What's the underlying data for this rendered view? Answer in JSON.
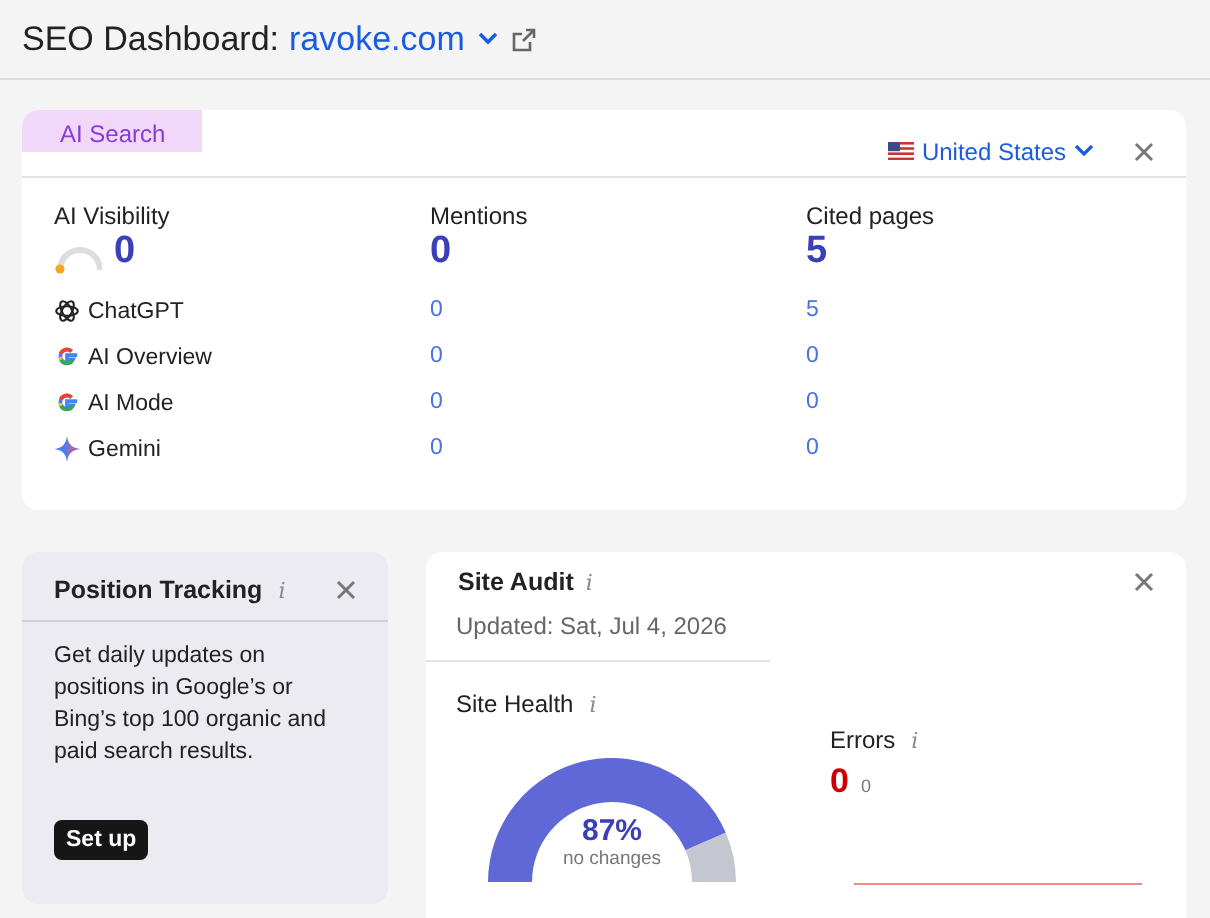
{
  "header": {
    "title": "SEO Dashboard:",
    "domain": "ravoke.com"
  },
  "ai_search": {
    "tab": "AI Search",
    "country": "United States",
    "columns": [
      {
        "label": "AI Visibility",
        "value": "0"
      },
      {
        "label": "Mentions",
        "value": "0"
      },
      {
        "label": "Cited pages",
        "value": "5"
      }
    ],
    "rows": [
      {
        "kind": "chatgpt",
        "name": "ChatGPT",
        "mentions": "0",
        "cited": "5"
      },
      {
        "kind": "google",
        "name": "AI Overview",
        "mentions": "0",
        "cited": "0"
      },
      {
        "kind": "google",
        "name": "AI Mode",
        "mentions": "0",
        "cited": "0"
      },
      {
        "kind": "gemini",
        "name": "Gemini",
        "mentions": "0",
        "cited": "0"
      }
    ]
  },
  "position_tracking": {
    "title": "Position Tracking",
    "info": "i",
    "text": "Get daily updates on positions in Google’s or Bing’s top 100 organic and paid search results.",
    "button": "Set up"
  },
  "site_audit": {
    "title": "Site Audit",
    "info": "i",
    "updated": "Updated: Sat, Jul 4, 2026",
    "health": {
      "label": "Site Health",
      "info": "i",
      "value": "87%",
      "note": "no changes"
    },
    "errors": {
      "label": "Errors",
      "info": "i",
      "value": "0",
      "change": "0"
    }
  }
}
